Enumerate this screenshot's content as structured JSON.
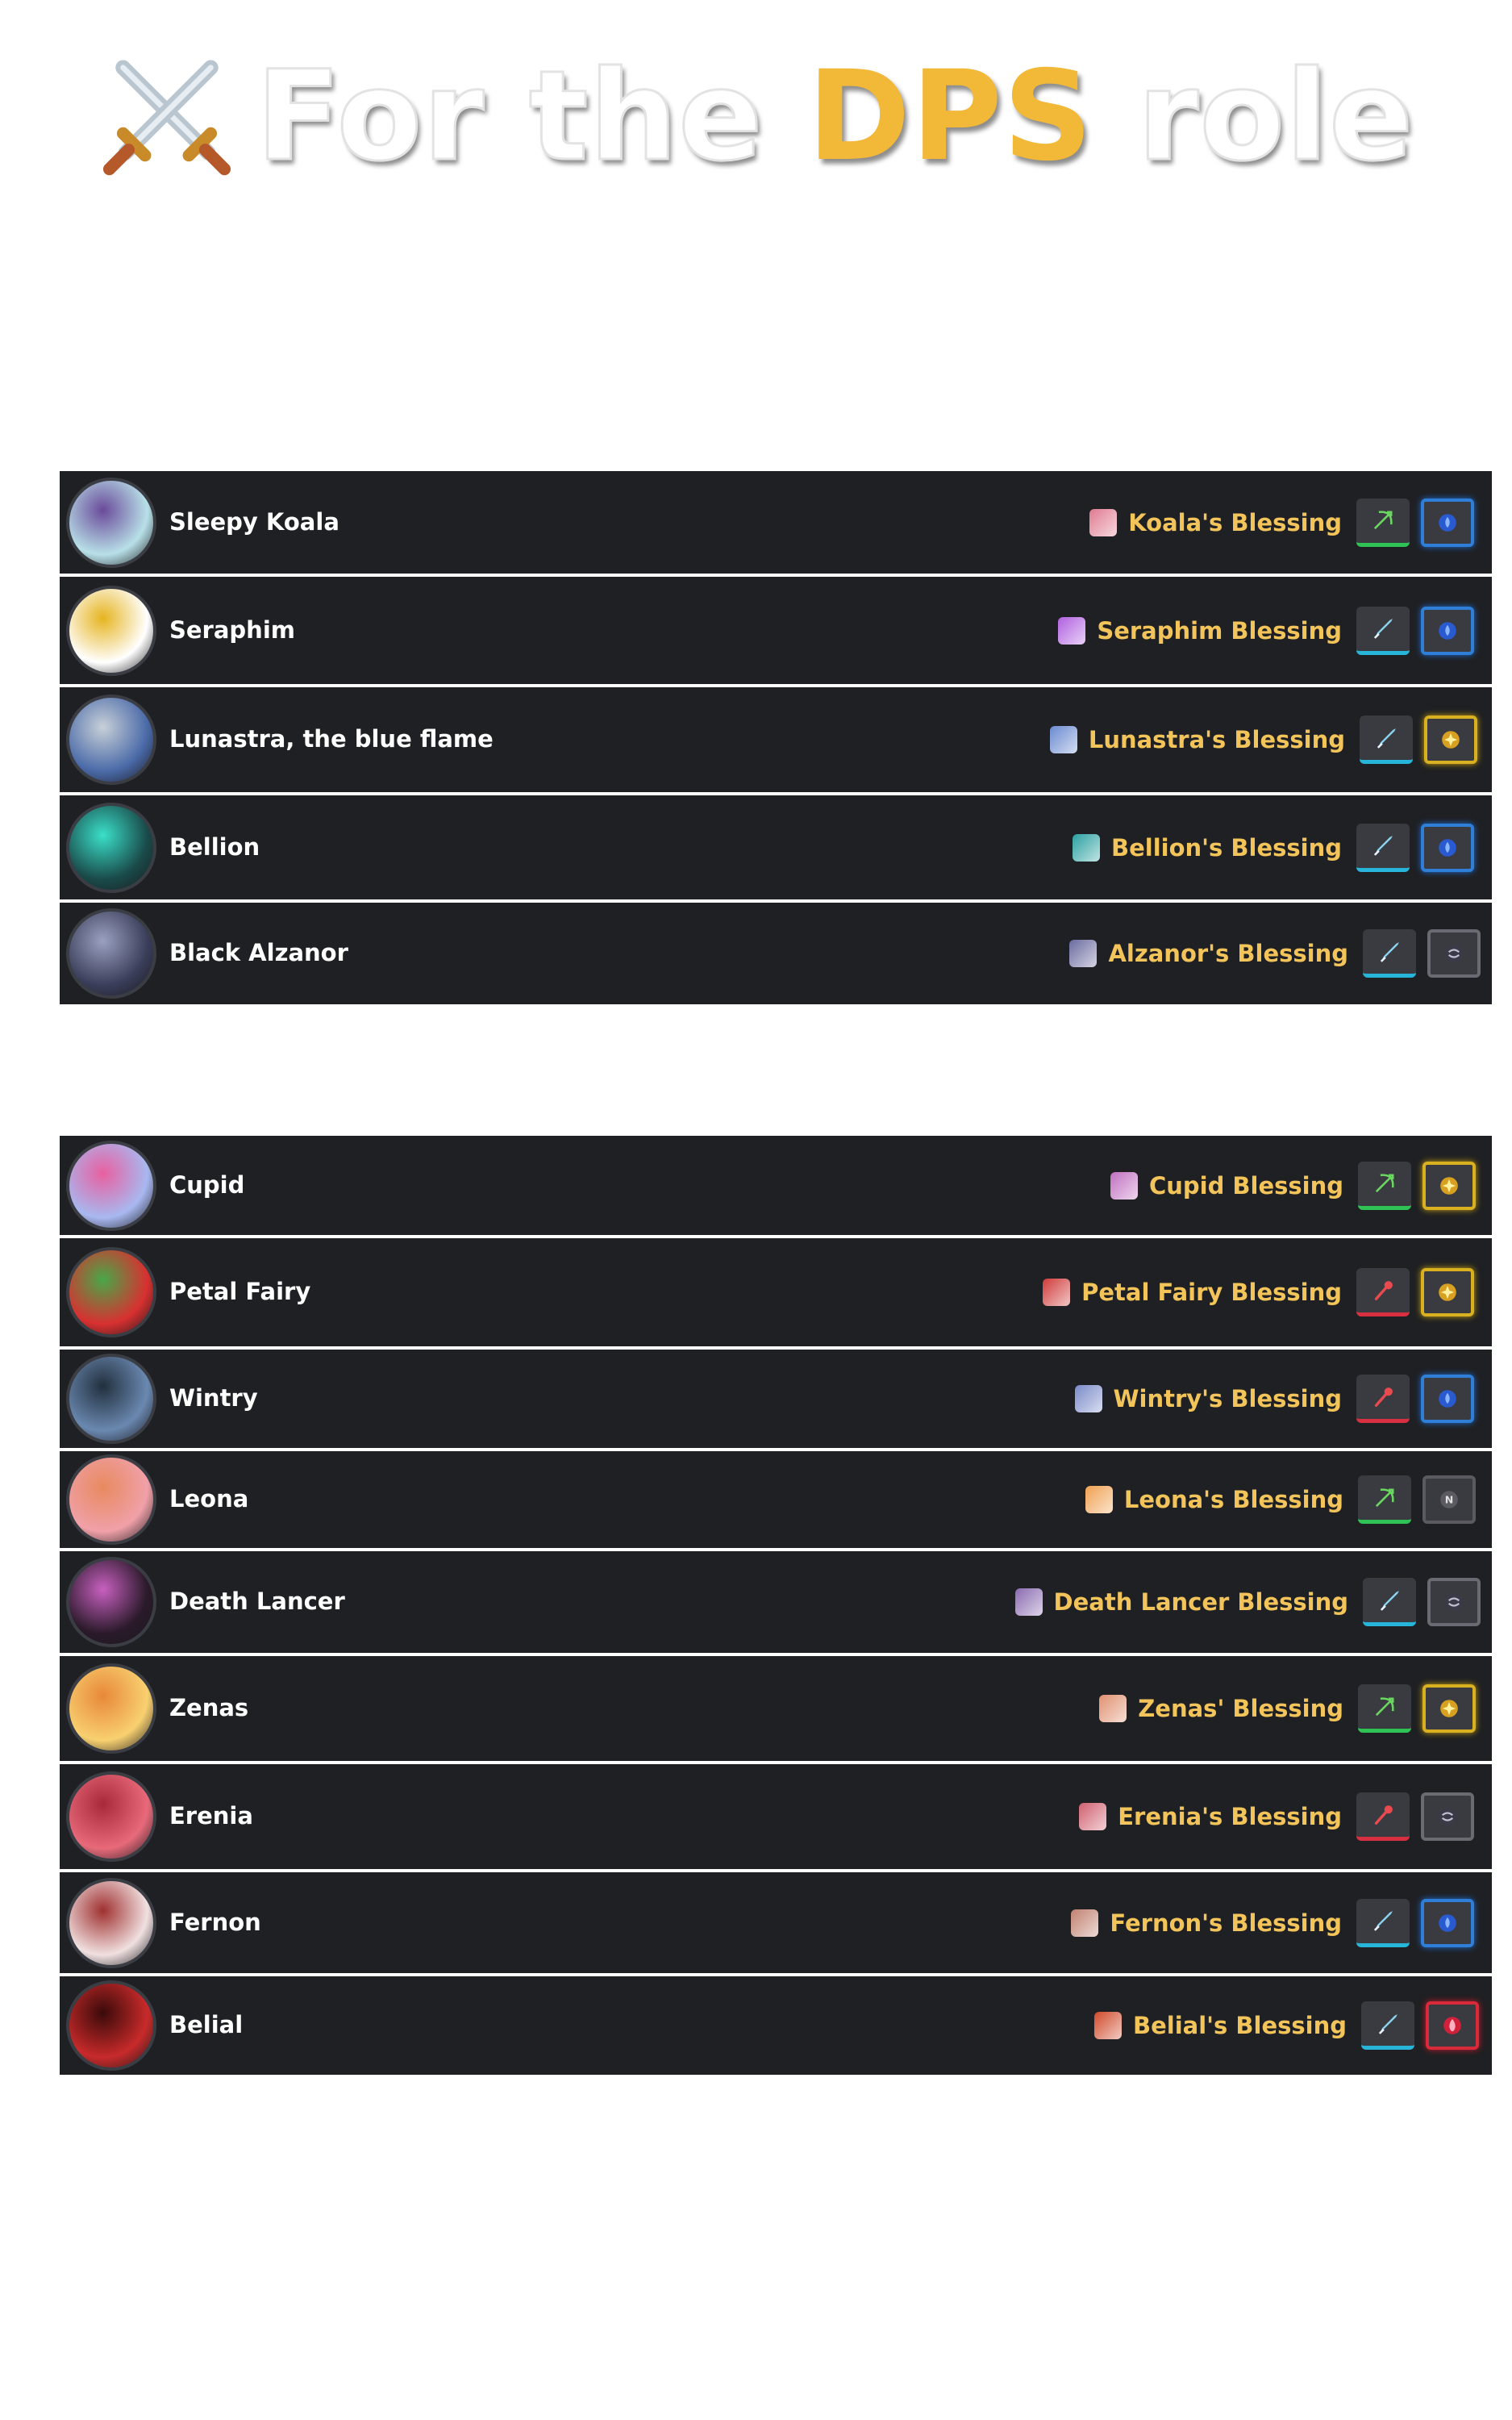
{
  "title": {
    "part1": "For the ",
    "part2": "DPS",
    "part3": " role"
  },
  "group1": [
    {
      "name": "Sleepy Koala",
      "blessing": "Koala's Blessing",
      "weapon": "bow",
      "element": "water"
    },
    {
      "name": "Seraphim",
      "blessing": "Seraphim Blessing",
      "weapon": "sword",
      "element": "water"
    },
    {
      "name": "Lunastra, the blue flame",
      "blessing": "Lunastra's Blessing",
      "weapon": "sword",
      "element": "light"
    },
    {
      "name": "Bellion",
      "blessing": "Bellion's Blessing",
      "weapon": "sword",
      "element": "water"
    },
    {
      "name": "Black Alzanor",
      "blessing": "Alzanor's Blessing",
      "weapon": "sword",
      "element": "dark"
    }
  ],
  "group2": [
    {
      "name": "Cupid",
      "blessing": "Cupid Blessing",
      "weapon": "bow",
      "element": "light"
    },
    {
      "name": "Petal Fairy",
      "blessing": "Petal Fairy Blessing",
      "weapon": "wand",
      "element": "light"
    },
    {
      "name": "Wintry",
      "blessing": "Wintry's Blessing",
      "weapon": "wand",
      "element": "water"
    },
    {
      "name": "Leona",
      "blessing": "Leona's Blessing",
      "weapon": "bow",
      "element": "none"
    },
    {
      "name": "Death Lancer",
      "blessing": "Death Lancer Blessing",
      "weapon": "sword",
      "element": "dark"
    },
    {
      "name": "Zenas",
      "blessing": "Zenas' Blessing",
      "weapon": "bow",
      "element": "light"
    },
    {
      "name": "Erenia",
      "blessing": "Erenia's Blessing",
      "weapon": "wand",
      "element": "dark"
    },
    {
      "name": "Fernon",
      "blessing": "Fernon's Blessing",
      "weapon": "sword",
      "element": "water"
    },
    {
      "name": "Belial",
      "blessing": "Belial's Blessing",
      "weapon": "sword",
      "element": "fire"
    }
  ],
  "colors": {
    "row_bg": "#1f2023",
    "gold": "#f2c45a",
    "title_gold": "#f2b838"
  }
}
